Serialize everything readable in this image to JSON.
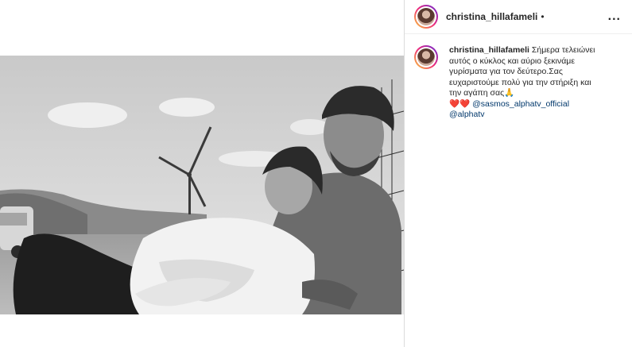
{
  "header": {
    "username": "christina_hillafameli",
    "separator": "•",
    "more_label": "..."
  },
  "caption": {
    "username": "christina_hillafameli",
    "text": "Σήμερα τελειώνει αυτός ο κύκλος και αύριο ξεκινάμε γυρίσματα για τον δεύτερο.Σας ευχαριστούμε πολύ για την στήριξη και την αγάπη σας🙏",
    "emoji_line": "❤️❤️",
    "mention_1": "@sasmos_alphatv_official",
    "mention_2": "@alphatv"
  },
  "colors": {
    "text": "#262626",
    "mention": "#00376b",
    "border": "#dbdbdb"
  }
}
